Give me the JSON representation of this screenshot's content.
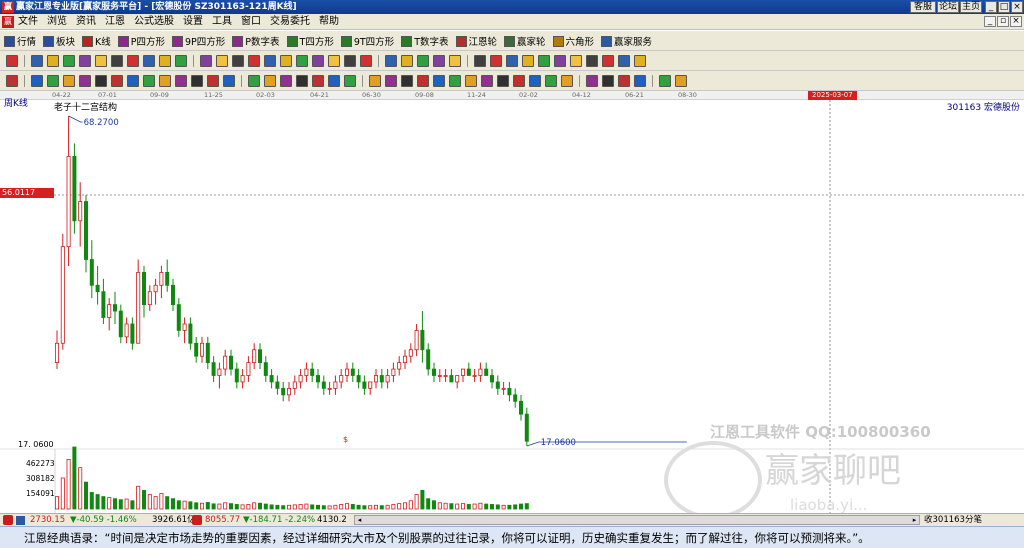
{
  "window": {
    "logo_glyph": "赢",
    "title": "赢家江恩专业版[赢家服务平台] - [宏德股份   SZ301163-121周K线]",
    "buttons": [
      "客服",
      "论坛",
      "主页"
    ]
  },
  "menu": {
    "logo_glyph": "赢",
    "items": [
      "文件",
      "浏览",
      "资讯",
      "江恩",
      "公式选股",
      "设置",
      "工具",
      "窗口",
      "交易委托",
      "帮助"
    ]
  },
  "toolbar1": {
    "items": [
      {
        "label": "行情",
        "icon": "grid-icon",
        "color": "#2b4d9a"
      },
      {
        "label": "板块",
        "icon": "blocks-icon",
        "color": "#2b4d9a"
      },
      {
        "label": "K线",
        "icon": "kline-icon",
        "color": "#c02020"
      },
      {
        "label": "P四方形",
        "icon": "p-square-icon",
        "color": "#8a2a8a"
      },
      {
        "label": "9P四方形",
        "icon": "9p-square-icon",
        "color": "#8a2a8a"
      },
      {
        "label": "P数字表",
        "icon": "p-table-icon",
        "color": "#8a2a8a"
      },
      {
        "label": "T四方形",
        "icon": "t-square-icon",
        "color": "#2a7a2a"
      },
      {
        "label": "9T四方形",
        "icon": "9t-square-icon",
        "color": "#2a7a2a"
      },
      {
        "label": "T数字表",
        "icon": "t-table-icon",
        "color": "#2a7a2a"
      },
      {
        "label": "江恩轮",
        "icon": "gann-wheel-icon",
        "color": "#b03030"
      },
      {
        "label": "赢家轮",
        "icon": "winner-wheel-icon",
        "color": "#3a6a3a"
      },
      {
        "label": "六角形",
        "icon": "hexagon-icon",
        "color": "#b07a10"
      },
      {
        "label": "赢家服务",
        "icon": "service-icon",
        "color": "#2a5aa0"
      }
    ]
  },
  "chart": {
    "period_label": "周K线",
    "stock_label": "301163  宏德股份",
    "pattern_label": "老子十二宫结构",
    "cursor_date": "2025-03-07",
    "cursor_price": "56.0117",
    "high_label": "68.2700",
    "low_label": "17.0600",
    "low_axis_label": "17. 0600",
    "dollar_mark": "$",
    "volume_labels": [
      "462273",
      "308182",
      "154091"
    ],
    "time_ticks": [
      "04-22",
      "07-01",
      "09-09",
      "11-25",
      "02-03",
      "04-21",
      "06-30",
      "09-08",
      "11-24",
      "02-02",
      "04-12",
      "06-21",
      "08-30"
    ],
    "watermark_text": "江恩工具软件  QQ:100800360",
    "watermark_brand": "赢家聊吧",
    "watermark_url": "liaoba.yi...",
    "colors": {
      "up": "#d41c1c",
      "down": "#118811",
      "cursor": "#d81e1e"
    }
  },
  "statusbar": {
    "index1": "2730.15",
    "index1_change": "▼-40.59  -1.46%",
    "index1_amount": "3926.61亿",
    "index2": "8055.77",
    "index2_change": "▼-184.71  -2.24%",
    "index2_amount": "4130.2",
    "right_text": "收301163分笔"
  },
  "footer": {
    "quote": "江恩经典语录：“时间是决定市场走势的重要因素，经过详细研究大市及个别股票的过往记录，你将可以证明，历史确实重复发生；而了解过往，你将可以预测将来。”。"
  },
  "chart_data": {
    "type": "candlestick",
    "cursor_date": "2025-03-07",
    "y_marks": {
      "high": 68.27,
      "low": 17.06,
      "cursor": 56.0117
    },
    "candles": [
      [
        30,
        35,
        29,
        33
      ],
      [
        33,
        50,
        32,
        48
      ],
      [
        48,
        68.27,
        45,
        62
      ],
      [
        62,
        64,
        50,
        52
      ],
      [
        52,
        58,
        48,
        55
      ],
      [
        55,
        56,
        44,
        46
      ],
      [
        46,
        49,
        40,
        42
      ],
      [
        42,
        45,
        39,
        41
      ],
      [
        41,
        43,
        36,
        37
      ],
      [
        37,
        40,
        35,
        39
      ],
      [
        39,
        41,
        36,
        38
      ],
      [
        38,
        39,
        33,
        34
      ],
      [
        34,
        37,
        33,
        36
      ],
      [
        36,
        37,
        32,
        33
      ],
      [
        33,
        46,
        33,
        44
      ],
      [
        44,
        45,
        37,
        39
      ],
      [
        39,
        42,
        38,
        41
      ],
      [
        41,
        43,
        39,
        42
      ],
      [
        42,
        45,
        40,
        44
      ],
      [
        44,
        46,
        41,
        42
      ],
      [
        42,
        43,
        38,
        39
      ],
      [
        39,
        40,
        34,
        35
      ],
      [
        35,
        37,
        33,
        36
      ],
      [
        36,
        37,
        32,
        33
      ],
      [
        33,
        34,
        30,
        31
      ],
      [
        31,
        34,
        30,
        33
      ],
      [
        33,
        34,
        29,
        30
      ],
      [
        30,
        31,
        27,
        28
      ],
      [
        28,
        30,
        26,
        29
      ],
      [
        29,
        32,
        28,
        31
      ],
      [
        31,
        32,
        28,
        29
      ],
      [
        29,
        30,
        26,
        27
      ],
      [
        27,
        29,
        26,
        28
      ],
      [
        28,
        31,
        27,
        30
      ],
      [
        30,
        33,
        29,
        32
      ],
      [
        32,
        33,
        29,
        30
      ],
      [
        30,
        31,
        27,
        28
      ],
      [
        28,
        29,
        26,
        27
      ],
      [
        27,
        28,
        25,
        26
      ],
      [
        26,
        27,
        24,
        25
      ],
      [
        25,
        27,
        24,
        26
      ],
      [
        26,
        28,
        25,
        27
      ],
      [
        27,
        29,
        26,
        28
      ],
      [
        28,
        30,
        27,
        29
      ],
      [
        29,
        30,
        27,
        28
      ],
      [
        28,
        29,
        26,
        27
      ],
      [
        27,
        28,
        25,
        26
      ],
      [
        26,
        27,
        25,
        26
      ],
      [
        26,
        28,
        25,
        27
      ],
      [
        27,
        29,
        26,
        28
      ],
      [
        28,
        30,
        27,
        29
      ],
      [
        29,
        30,
        27,
        28
      ],
      [
        28,
        29,
        26,
        27
      ],
      [
        27,
        28,
        25,
        26
      ],
      [
        26,
        27,
        25,
        27
      ],
      [
        27,
        29,
        26,
        28
      ],
      [
        28,
        29,
        26,
        27
      ],
      [
        27,
        29,
        26,
        28
      ],
      [
        28,
        30,
        27,
        29
      ],
      [
        29,
        31,
        28,
        30
      ],
      [
        30,
        32,
        29,
        31
      ],
      [
        31,
        33,
        30,
        32
      ],
      [
        32,
        36,
        31,
        35
      ],
      [
        35,
        38,
        30,
        32
      ],
      [
        32,
        33,
        28,
        29
      ],
      [
        29,
        30,
        27,
        28
      ],
      [
        28,
        29,
        27,
        28
      ],
      [
        28,
        29,
        27,
        28
      ],
      [
        28,
        29,
        27,
        27
      ],
      [
        27,
        28,
        26,
        28
      ],
      [
        28,
        29,
        27,
        29
      ],
      [
        29,
        30,
        28,
        28
      ],
      [
        28,
        29,
        27,
        28
      ],
      [
        28,
        30,
        27,
        29
      ],
      [
        29,
        30,
        28,
        28
      ],
      [
        28,
        29,
        26,
        27
      ],
      [
        27,
        28,
        25,
        26
      ],
      [
        26,
        27,
        25,
        26
      ],
      [
        26,
        27,
        24,
        25
      ],
      [
        25,
        26,
        23,
        24
      ],
      [
        24,
        25,
        21,
        22
      ],
      [
        22,
        23,
        17.06,
        17.8
      ]
    ],
    "volume": [
      60,
      150,
      240,
      300,
      200,
      130,
      80,
      70,
      60,
      55,
      50,
      45,
      48,
      40,
      110,
      90,
      70,
      60,
      75,
      60,
      50,
      40,
      38,
      35,
      30,
      28,
      32,
      25,
      24,
      30,
      26,
      22,
      20,
      22,
      30,
      28,
      24,
      20,
      18,
      16,
      18,
      20,
      22,
      24,
      20,
      18,
      16,
      15,
      18,
      22,
      26,
      22,
      18,
      16,
      16,
      18,
      16,
      18,
      22,
      26,
      30,
      40,
      70,
      90,
      50,
      40,
      30,
      28,
      26,
      24,
      26,
      22,
      24,
      28,
      24,
      22,
      20,
      18,
      18,
      20,
      24,
      26
    ],
    "volume_axis": [
      154091,
      308182,
      462273
    ]
  }
}
